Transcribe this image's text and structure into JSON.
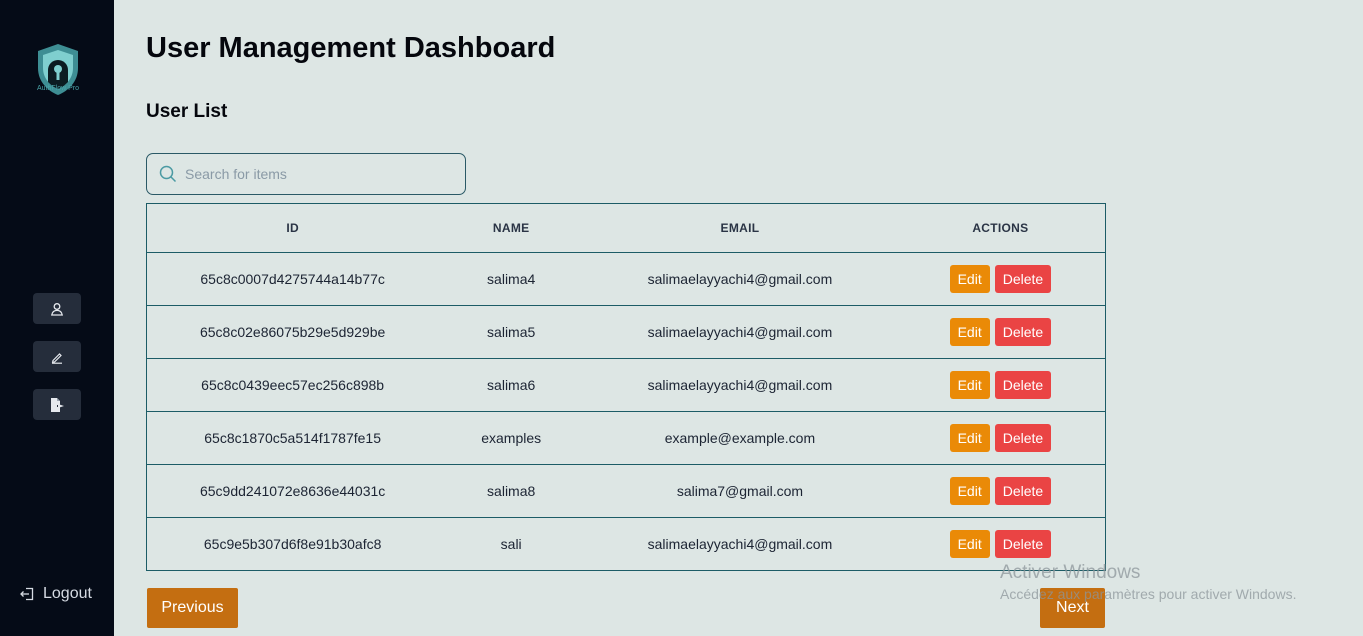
{
  "sidebar": {
    "logo_text": "AuthFlow Pro",
    "nav_icons": [
      "user-icon",
      "pencil-icon",
      "export-file-icon"
    ],
    "logout_label": "Logout"
  },
  "header": {
    "title": "User Management Dashboard",
    "subtitle": "User List"
  },
  "search": {
    "placeholder": "Search for items",
    "value": ""
  },
  "table": {
    "columns": [
      "ID",
      "NAME",
      "EMAIL",
      "ACTIONS"
    ],
    "rows": [
      {
        "id": "65c8c0007d4275744a14b77c",
        "name": "salima4",
        "email": "salimaelayyachi4@gmail.com"
      },
      {
        "id": "65c8c02e86075b29e5d929be",
        "name": "salima5",
        "email": "salimaelayyachi4@gmail.com"
      },
      {
        "id": "65c8c0439eec57ec256c898b",
        "name": "salima6",
        "email": "salimaelayyachi4@gmail.com"
      },
      {
        "id": "65c8c1870c5a514f1787fe15",
        "name": "examples",
        "email": "example@example.com"
      },
      {
        "id": "65c9dd241072e8636e44031c",
        "name": "salima8",
        "email": "salima7@gmail.com"
      },
      {
        "id": "65c9e5b307d6f8e91b30afc8",
        "name": "sali",
        "email": "salimaelayyachi4@gmail.com"
      }
    ],
    "edit_label": "Edit",
    "delete_label": "Delete"
  },
  "pagination": {
    "previous_label": "Previous",
    "next_label": "Next"
  },
  "watermark": {
    "line1": "Activer Windows",
    "line2": "Accédez aux paramètres pour activer Windows."
  },
  "colors": {
    "sidebar_bg": "#050b17",
    "page_bg": "#dde6e4",
    "edit": "#ea8a07",
    "delete": "#ea4444",
    "pagination": "#c46e11",
    "table_border": "#1c5c66"
  }
}
